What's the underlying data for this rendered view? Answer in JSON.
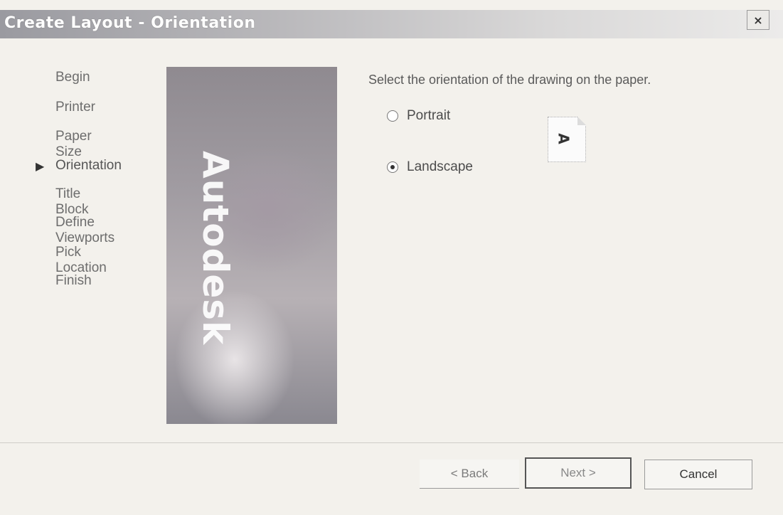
{
  "window": {
    "title": "Create Layout - Orientation",
    "close_label": "×"
  },
  "steps": {
    "items": [
      {
        "label": "Begin"
      },
      {
        "label": "Printer"
      },
      {
        "label": "Paper Size"
      },
      {
        "label": "Orientation",
        "active": true
      },
      {
        "label": "Title Block"
      },
      {
        "label": "Define Viewports"
      },
      {
        "label": "Pick Location"
      },
      {
        "label": "Finish"
      }
    ],
    "current_marker": "▶"
  },
  "banner": {
    "brand": "Autodesk"
  },
  "content": {
    "prompt": "Select the orientation of the drawing on the paper.",
    "options": [
      {
        "label": "Portrait",
        "selected": false
      },
      {
        "label": "Landscape",
        "selected": true
      }
    ],
    "preview_letter": "A"
  },
  "buttons": {
    "back": "< Back",
    "next": "Next >",
    "cancel": "Cancel"
  }
}
